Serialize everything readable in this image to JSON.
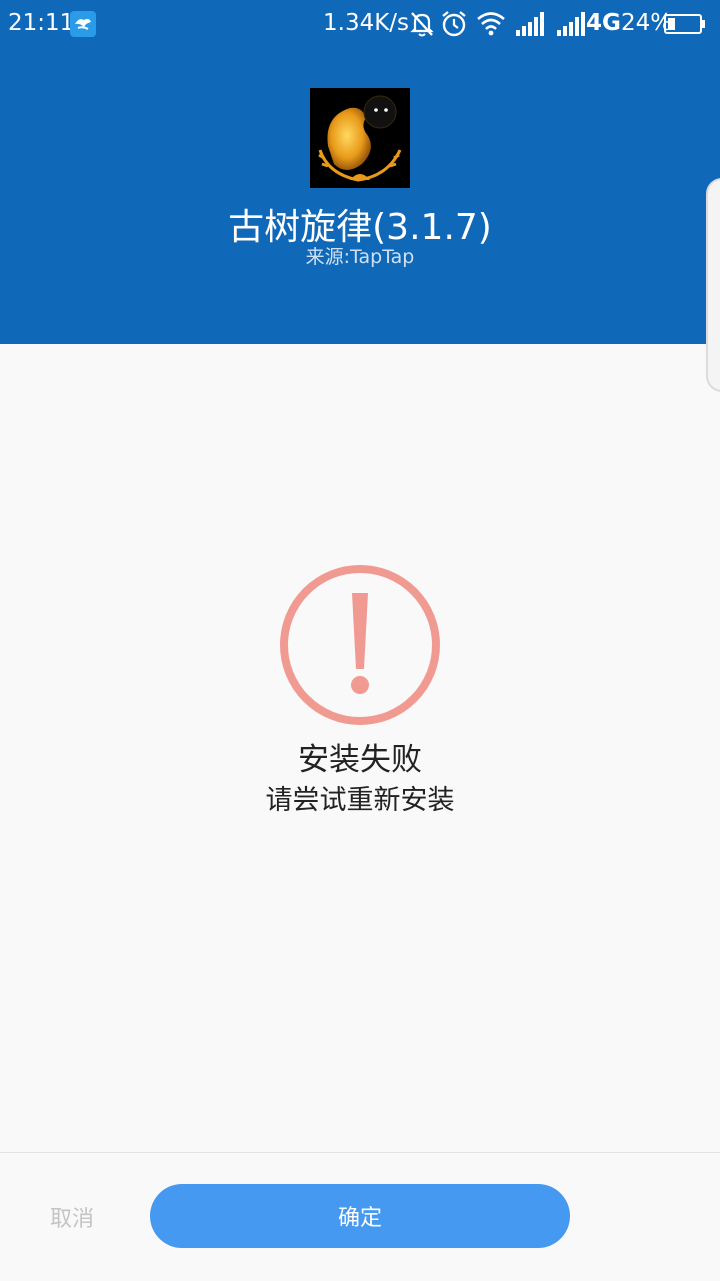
{
  "status_bar": {
    "time": "21:11",
    "net_speed": "1.34K/s",
    "network_type": "4G",
    "battery_percent": "24%",
    "battery_level": 0.24,
    "icons": [
      "notification-app-icon",
      "mute-icon",
      "alarm-icon",
      "wifi-icon",
      "signal-icon",
      "signal-icon",
      "battery-icon"
    ]
  },
  "app": {
    "name": "古树旋律(3.1.7)",
    "source": "来源:TapTap"
  },
  "result": {
    "icon": "warning-circle-icon",
    "title": "安装失败",
    "subtitle": "请尝试重新安装"
  },
  "buttons": {
    "cancel": "取消",
    "confirm": "确定"
  },
  "colors": {
    "header_bg": "#1068b8",
    "error_icon": "#f19a92",
    "confirm_bg": "#4599f0"
  }
}
